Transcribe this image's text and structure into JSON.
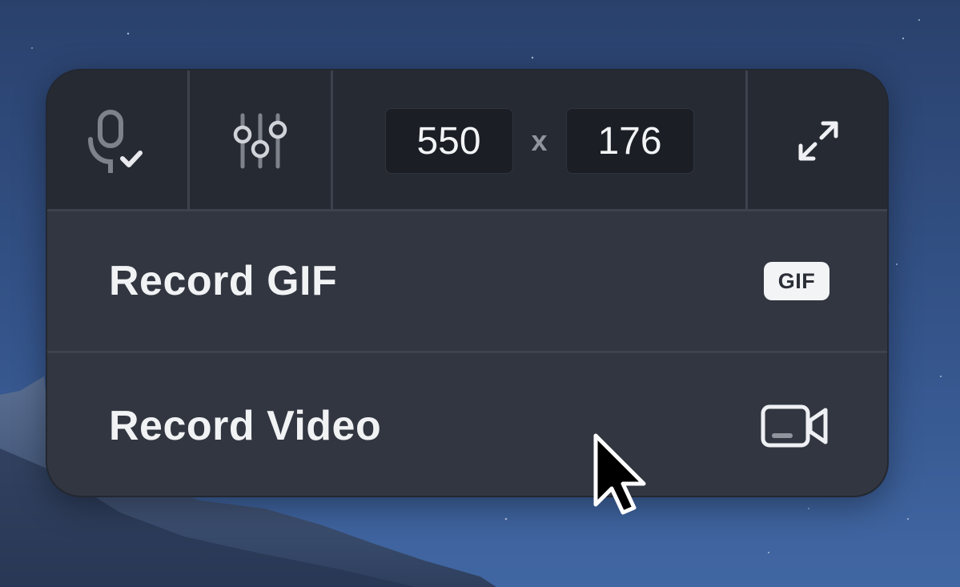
{
  "toolbar": {
    "icons": {
      "mic": "microphone-check-icon",
      "sliders": "sliders-icon",
      "expand": "expand-icon"
    },
    "width_value": "550",
    "separator": "x",
    "height_value": "176"
  },
  "menu": {
    "items": [
      {
        "label": "Record GIF",
        "badge": "GIF",
        "icon": "gif-badge-icon"
      },
      {
        "label": "Record Video",
        "icon": "video-camera-icon"
      }
    ]
  },
  "colors": {
    "panel_bg": "#313640",
    "toolbar_bg": "#262a33",
    "text": "#f1f2f4",
    "icon": "#d0d3d8",
    "icon_muted": "#7d828b",
    "desktop_blue": "#34548a"
  }
}
